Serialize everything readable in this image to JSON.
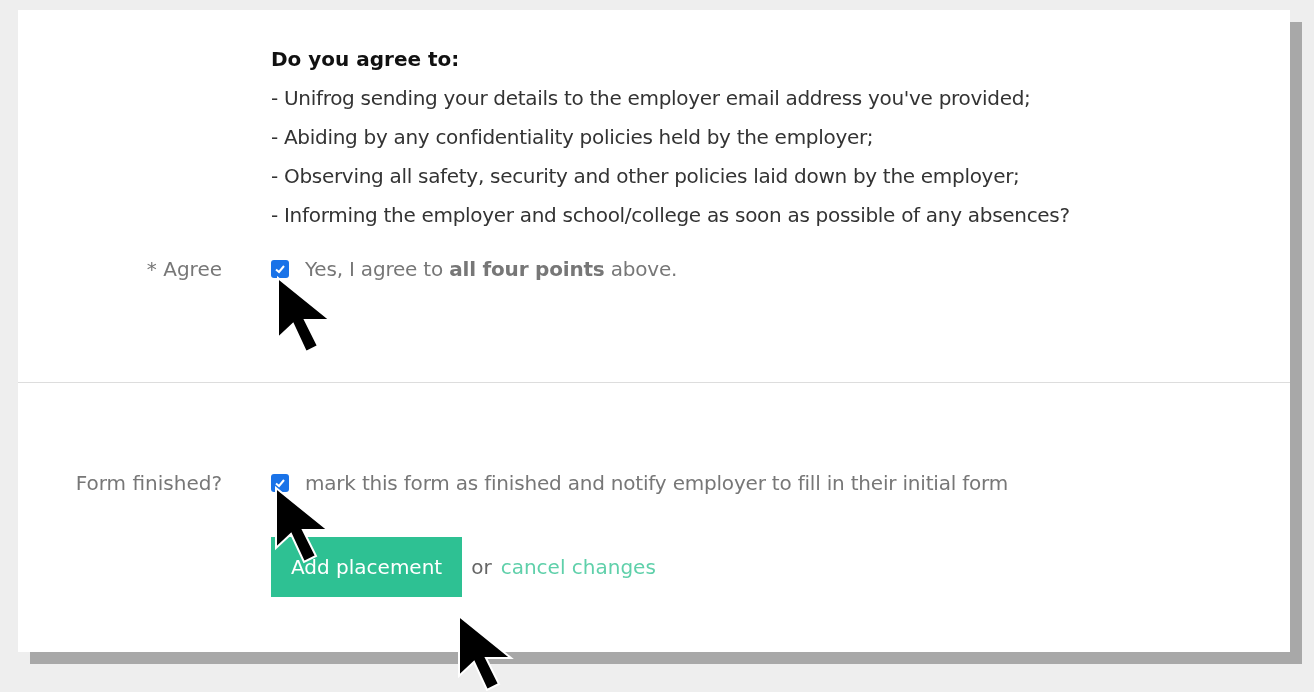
{
  "agreement": {
    "heading": "Do you agree to:",
    "points": [
      "- Unifrog sending your details to the employer email address you've provided;",
      "- Abiding by any confidentiality policies held by the employer;",
      "- Observing all safety, security and other policies laid down by the employer;",
      "- Informing the employer and school/college as soon as possible of any absences?"
    ]
  },
  "fields": [
    {
      "label": "* Agree",
      "checked": true,
      "text": "Yes, I agree to **all four points** above."
    },
    {
      "label": "Form finished?",
      "checked": true,
      "text": "mark this form as finished and notify employer to fill in their initial form"
    }
  ],
  "actions": {
    "submit": "Add placement",
    "separator": "or",
    "cancel": "cancel changes"
  }
}
